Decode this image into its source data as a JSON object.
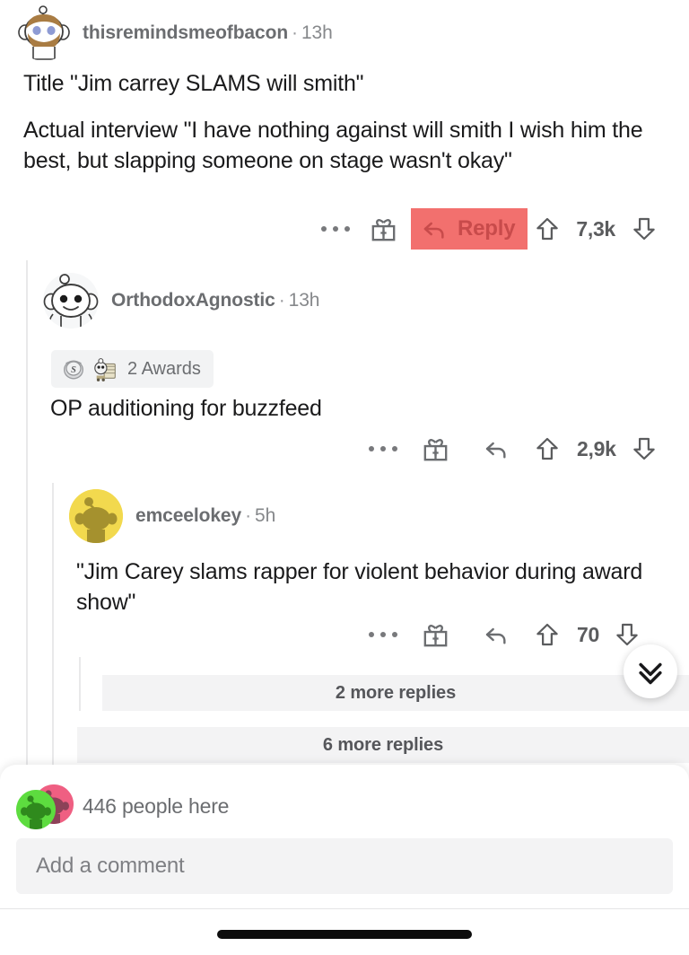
{
  "app": "reddit-comments",
  "colors": {
    "reply_highlight": "#f2706e",
    "reply_text": "#c84b4b",
    "thread_line": "#e9e9ea",
    "pill_bg": "#f2f3f4",
    "more_replies_bg": "#f3f3f4",
    "text_primary": "#1a1a1b",
    "text_meta": "#6b6d70",
    "avatar_yellow": "#f2d94e",
    "avatar_green": "#5ddc3f",
    "avatar_pink": "#ef5f82"
  },
  "comments": [
    {
      "id": "c1",
      "depth": 0,
      "author": "thisremindsmeofbacon",
      "separator": "·",
      "time": "13h",
      "avatar": "snoo-brown-beard-avatar",
      "paragraphs": [
        "Title  \"Jim carrey SLAMS will smith\"",
        "Actual interview  \"I have nothing against will smith I wish him the best, but slapping someone on stage wasn't okay\""
      ],
      "awards": null,
      "actions": {
        "overflow": "more-options",
        "award": "give-award",
        "reply_label": "Reply",
        "reply_highlighted": true,
        "score": "7,3k",
        "upvote": "upvote",
        "downvote": "downvote"
      }
    },
    {
      "id": "c2",
      "depth": 1,
      "author": "OrthodoxAgnostic",
      "separator": "·",
      "time": "13h",
      "avatar": "snoo-white-avatar",
      "paragraphs": [
        "OP auditioning for buzzfeed"
      ],
      "awards": {
        "label": "2 Awards",
        "icons": [
          "silver-award-icon",
          "wholesome-award-icon"
        ]
      },
      "actions": {
        "overflow": "more-options",
        "award": "give-award",
        "reply_label": "",
        "reply_highlighted": false,
        "score": "2,9k",
        "upvote": "upvote",
        "downvote": "downvote"
      }
    },
    {
      "id": "c3",
      "depth": 2,
      "author": "emceelokey",
      "separator": "·",
      "time": "5h",
      "avatar": "snoo-yellow-avatar",
      "paragraphs": [
        "\"Jim Carey slams rapper for violent behavior during award show\""
      ],
      "awards": null,
      "actions": {
        "overflow": "more-options",
        "award": "give-award",
        "reply_label": "",
        "reply_highlighted": false,
        "score": "70",
        "upvote": "upvote",
        "downvote": "downvote"
      }
    }
  ],
  "more_replies": [
    {
      "label": "2 more replies",
      "depth": 3
    },
    {
      "label": "6 more replies",
      "depth": 2
    }
  ],
  "next_comment_button": {
    "icon": "double-chevron-down-icon"
  },
  "bottom_sheet": {
    "people_here": "446 people here",
    "comment_placeholder": "Add a comment"
  }
}
